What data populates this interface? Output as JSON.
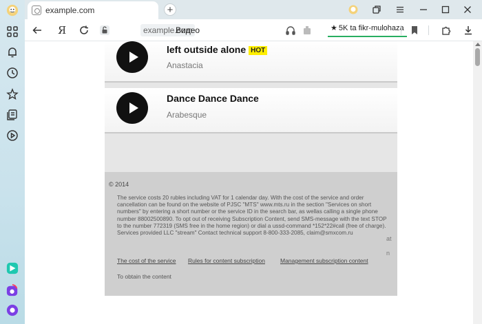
{
  "browser": {
    "tab_title": "example.com",
    "new_tab_label": "+",
    "yandex_letter": "Я",
    "url_host": "example.com",
    "url_page": "Видео",
    "reviews_label": "5K ta fikr-mulohaza",
    "reviews_star": "★"
  },
  "tracks": [
    {
      "title": "left outside alone",
      "badge": "HOT",
      "artist": "Anastacia"
    },
    {
      "title": "Dance Dance Dance",
      "badge": "",
      "artist": "Arabesque"
    }
  ],
  "footer": {
    "copyright": "© 2014",
    "legal_text": "The service costs 20 rubles including VAT for 1 calendar day. With the cost of the service and order cancellation can be found on the website of PJSC \"MTS\" www.mts.ru in the section \"Services on short numbers\" by entering a short number or the service ID in the search bar, as wellas calling a single phone number 88002500890. To opt out of receiving Subscription Content, send SMS-message with the text STOP to the number 772319 (SMS free in the home region) or dial a ussd-command *152*22#call (free of charge). Services provided LLC \"stream\" Contact technical support 8-800-333-2085, claim@smxcom.ru",
    "links": [
      "The cost of the service",
      "Rules for content subscription",
      "Management subscription content"
    ],
    "obtain_text": "To obtain the content",
    "stray_at": "at",
    "stray_n": "n"
  },
  "colors": {
    "hot_badge": "#ffee00",
    "review_underline": "#27ae60",
    "alice_purple": "#7b3fe4"
  }
}
